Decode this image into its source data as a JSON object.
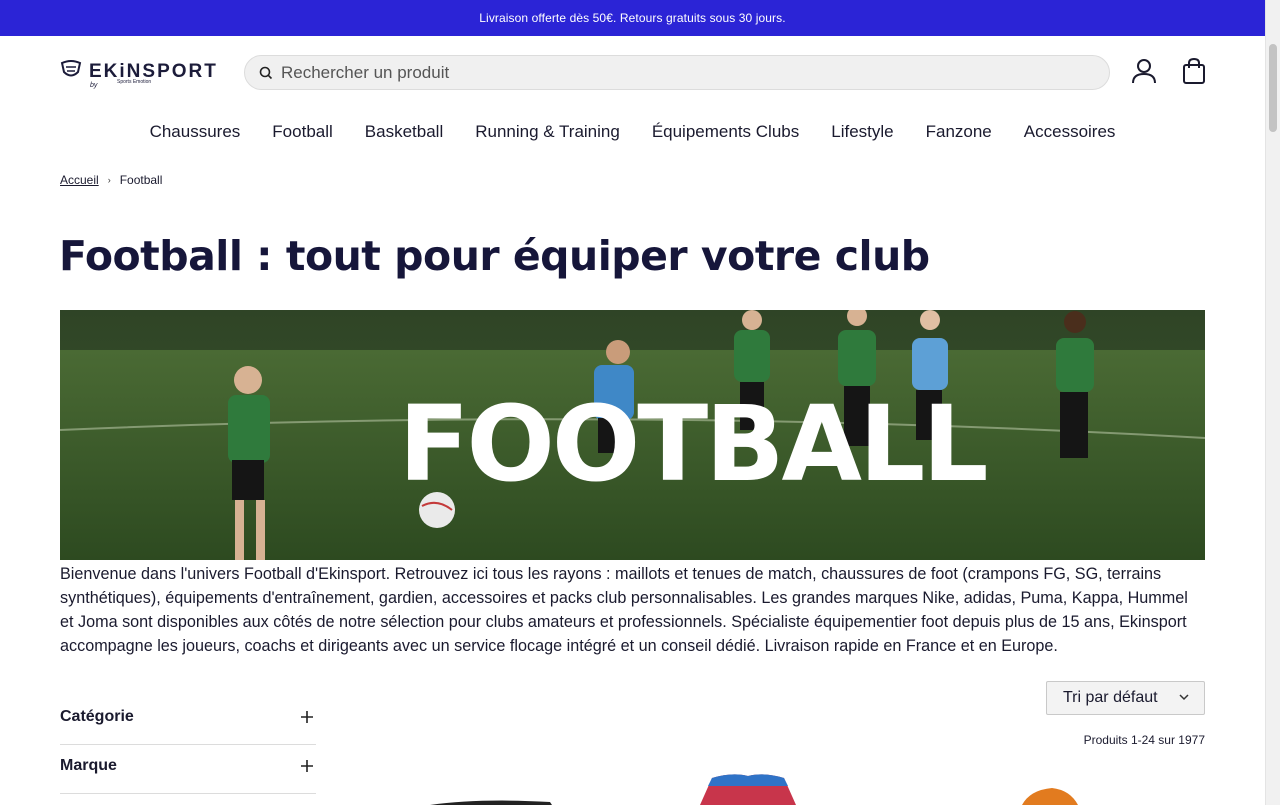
{
  "promo_bar": {
    "text": "Livraison offerte dès 50€. Retours gratuits sous 30 jours."
  },
  "header": {
    "logo": {
      "brand": "EKiNSPORT",
      "by": "by",
      "sub": "Sports Emotion"
    },
    "search": {
      "placeholder": "Rechercher un produit",
      "value": ""
    },
    "icons": [
      "search-icon",
      "account-icon",
      "bag-icon"
    ]
  },
  "nav": {
    "items": [
      "Chaussures",
      "Football",
      "Basketball",
      "Running & Training",
      "Équipements Clubs",
      "Lifestyle",
      "Fanzone",
      "Accessoires"
    ]
  },
  "breadcrumb": {
    "home": "Accueil",
    "current": "Football"
  },
  "page": {
    "title": "Football : tout pour équiper votre club",
    "hero_text": "FOOTBALL",
    "intro": "Bienvenue dans l'univers Football d'Ekinsport. Retrouvez ici tous les rayons : maillots et tenues de match, chaussures de foot (crampons FG, SG, terrains synthétiques), équipements d'entraînement, gardien, accessoires et packs club personnalisables. Les grandes marques Nike, adidas, Puma, Kappa, Hummel et Joma sont disponibles aux côtés de notre sélection pour clubs amateurs et professionnels. Spécialiste équipementier foot depuis plus de 15 ans, Ekinsport accompagne les joueurs, coachs et dirigeants avec un service flocage intégré et un conseil dédié. Livraison rapide en France et en Europe."
  },
  "filters": {
    "facets": [
      "Catégorie",
      "Marque"
    ]
  },
  "listing": {
    "sort_label": "Tri par défaut",
    "count_text": "Produits 1-24 sur 1977"
  },
  "colors": {
    "promo": "#2b24d6",
    "text": "#1a1a2e",
    "pitch": "#3f5a2c",
    "jersey": "#2f7a3c"
  }
}
